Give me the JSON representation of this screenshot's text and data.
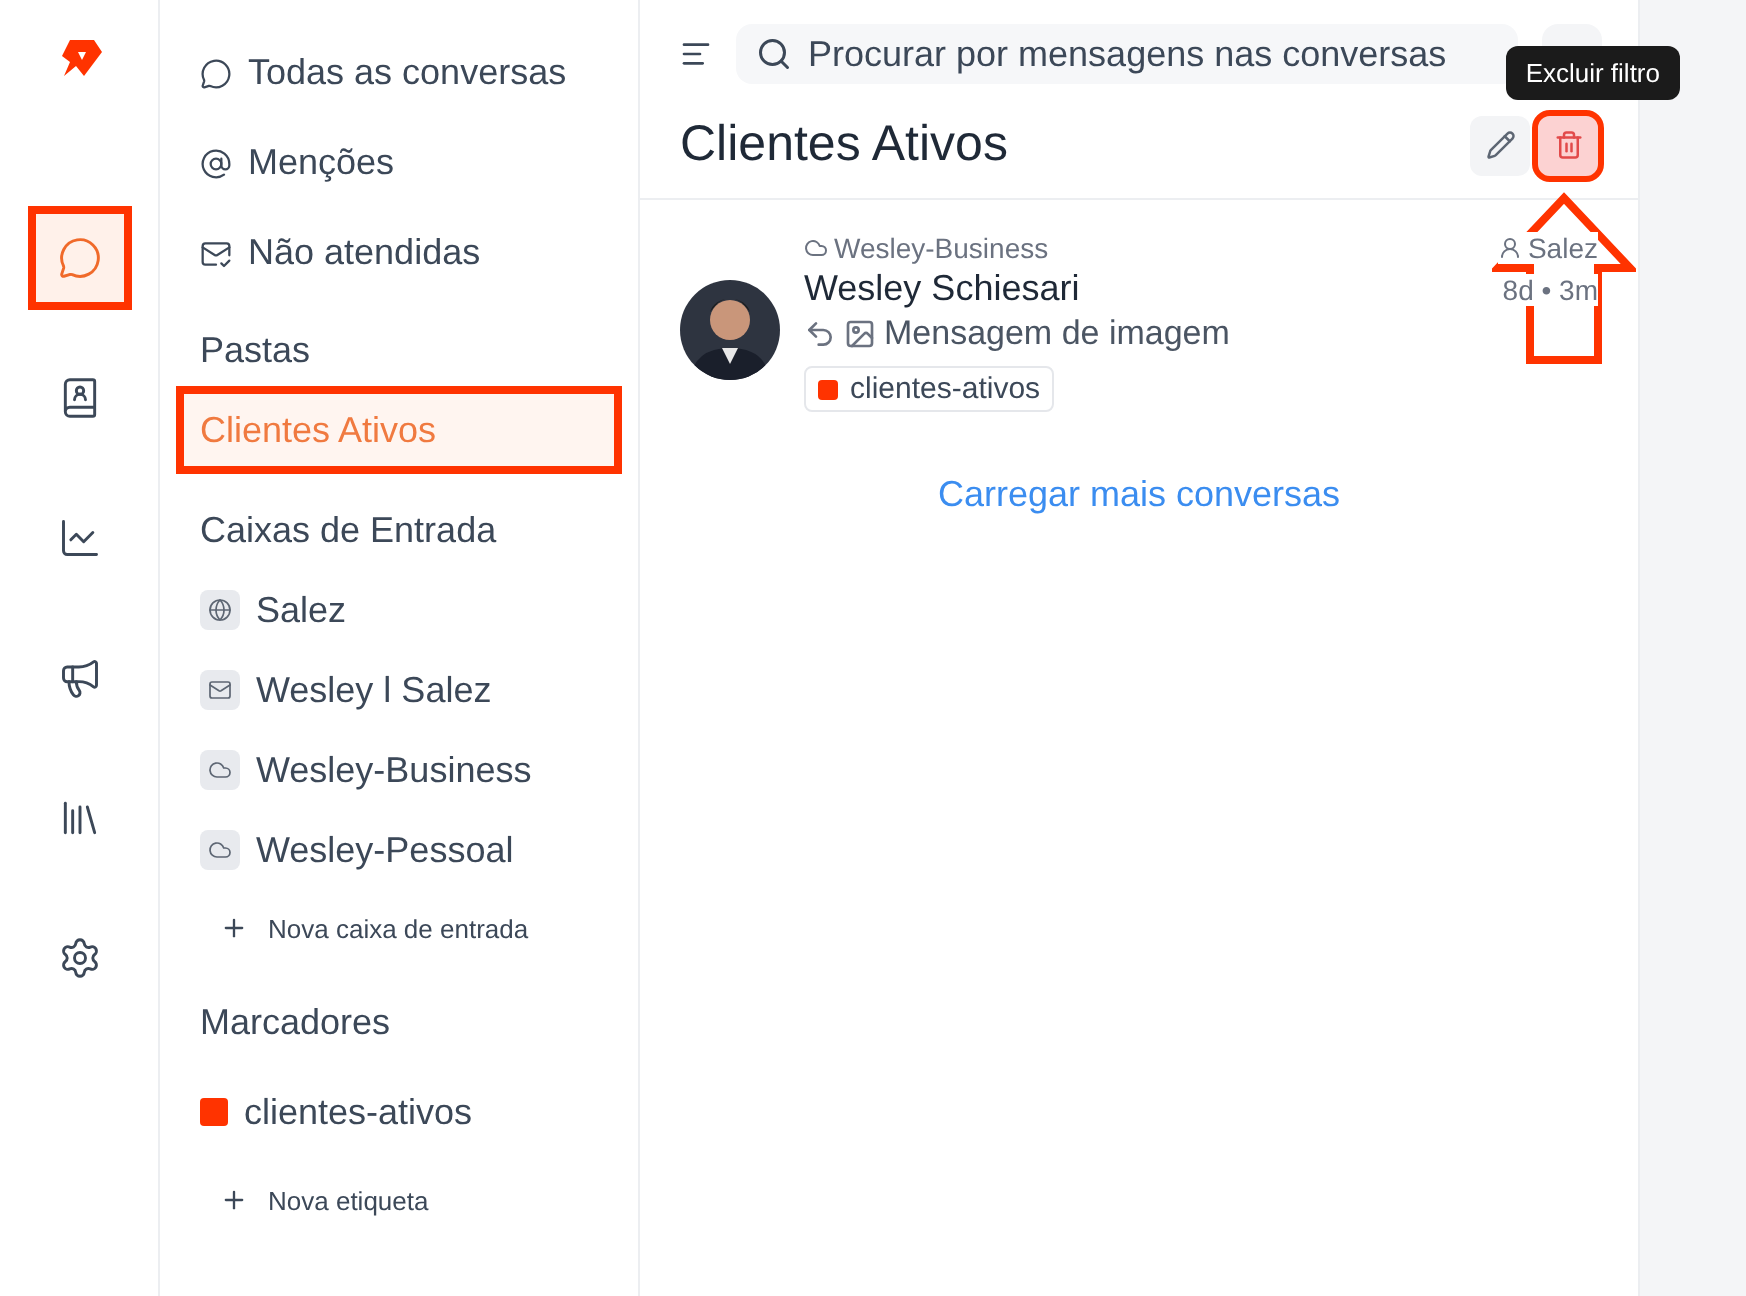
{
  "rail": {
    "items": [
      {
        "kind": "chat",
        "selected": true,
        "highlighted": true
      },
      {
        "kind": "contacts",
        "selected": false,
        "highlighted": false
      },
      {
        "kind": "reports",
        "selected": false,
        "highlighted": false
      },
      {
        "kind": "campaigns",
        "selected": false,
        "highlighted": false
      },
      {
        "kind": "library",
        "selected": false,
        "highlighted": false
      },
      {
        "kind": "settings",
        "selected": false,
        "highlighted": false
      }
    ]
  },
  "sidebar": {
    "views": [
      {
        "kind": "chat",
        "label": "Todas as conversas"
      },
      {
        "kind": "mention",
        "label": "Menções"
      },
      {
        "kind": "unread",
        "label": "Não atendidas"
      }
    ],
    "folders_title": "Pastas",
    "folders": [
      {
        "label": "Clientes Ativos",
        "selected": true,
        "highlighted": true
      }
    ],
    "inboxes_title": "Caixas de Entrada",
    "inboxes": [
      {
        "kind": "web",
        "label": "Salez"
      },
      {
        "kind": "email",
        "label": "Wesley l Salez"
      },
      {
        "kind": "api",
        "label": "Wesley-Business"
      },
      {
        "kind": "api",
        "label": "Wesley-Pessoal"
      }
    ],
    "new_inbox": "Nova caixa de entrada",
    "labels_title": "Marcadores",
    "labels": [
      {
        "label": "clientes-ativos",
        "color": "#ff3300"
      }
    ],
    "new_label": "Nova etiqueta"
  },
  "main": {
    "search": {
      "placeholder": "Procurar por mensagens nas conversas"
    },
    "title": "Clientes Ativos",
    "delete_button": {
      "highlighted": true,
      "tooltip": "Excluir filtro"
    },
    "conversations": [
      {
        "inbox": "Wesley-Business",
        "agent": "Salez",
        "name": "Wesley Schiesari",
        "time": "8d • 3m",
        "message": "Mensagem de imagem",
        "tags": [
          {
            "label": "clientes-ativos",
            "color": "#ff3300"
          }
        ]
      }
    ],
    "load_more": "Carregar mais conversas"
  }
}
